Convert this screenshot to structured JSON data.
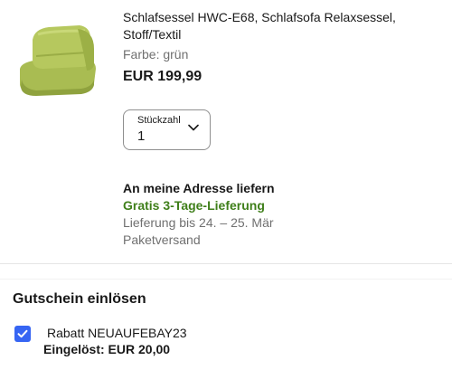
{
  "product": {
    "image_icon": "green-sofa-chair-image",
    "title": "Schlafsessel HWC-E68, Schlafsofa Relaxsessel, Stoff/Textil",
    "variant": "Farbe: grün",
    "price": "EUR 199,99"
  },
  "quantity": {
    "label": "Stückzahl",
    "value": "1",
    "icon": "chevron-down-icon"
  },
  "shipping": {
    "heading": "An meine Adresse liefern",
    "free_label": "Gratis 3-Tage-Lieferung",
    "delivery_date": "Lieferung bis 24. – 25. Mär",
    "method": "Paketversand"
  },
  "coupon": {
    "heading": "Gutschein einlösen",
    "checkbox_checked": true,
    "code_label": "Rabatt NEUAUFEBAY23",
    "applied_text": "Eingelöst: EUR 20,00"
  },
  "colors": {
    "accent_blue": "#3665f3",
    "shipping_green": "#3f7f1a",
    "secondary_text": "#707070"
  }
}
